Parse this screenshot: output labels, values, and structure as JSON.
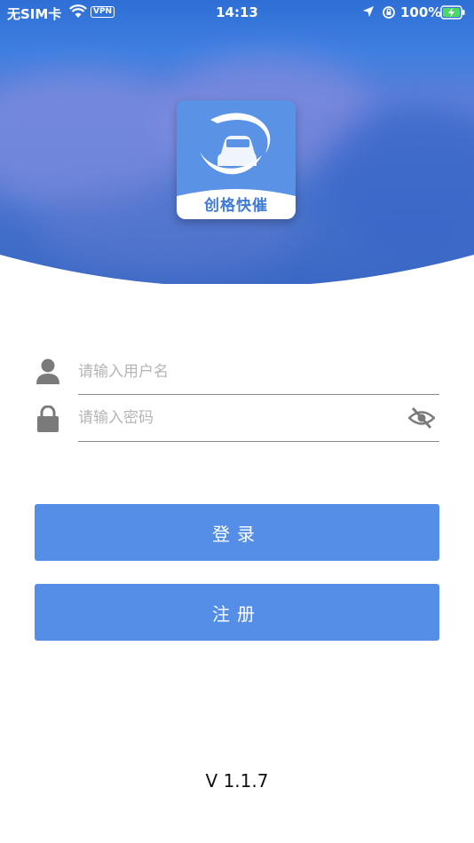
{
  "status_bar": {
    "carrier": "无SIM卡",
    "vpn": "VPN",
    "time": "14:13",
    "battery": "100%"
  },
  "logo": {
    "text": "创格快催",
    "icon": "car-swoosh-logo"
  },
  "login_form": {
    "username_placeholder": "请输入用户名",
    "password_placeholder": "请输入密码",
    "username_icon": "user-icon",
    "password_icon": "lock-icon",
    "toggle_icon": "eye-slash-icon"
  },
  "buttons": {
    "login": "登录",
    "register": "注册"
  },
  "version": "V 1.1.7",
  "colors": {
    "primary": "#548ee6",
    "hero": "#3f7fe0",
    "placeholder": "#b5b5b5"
  }
}
